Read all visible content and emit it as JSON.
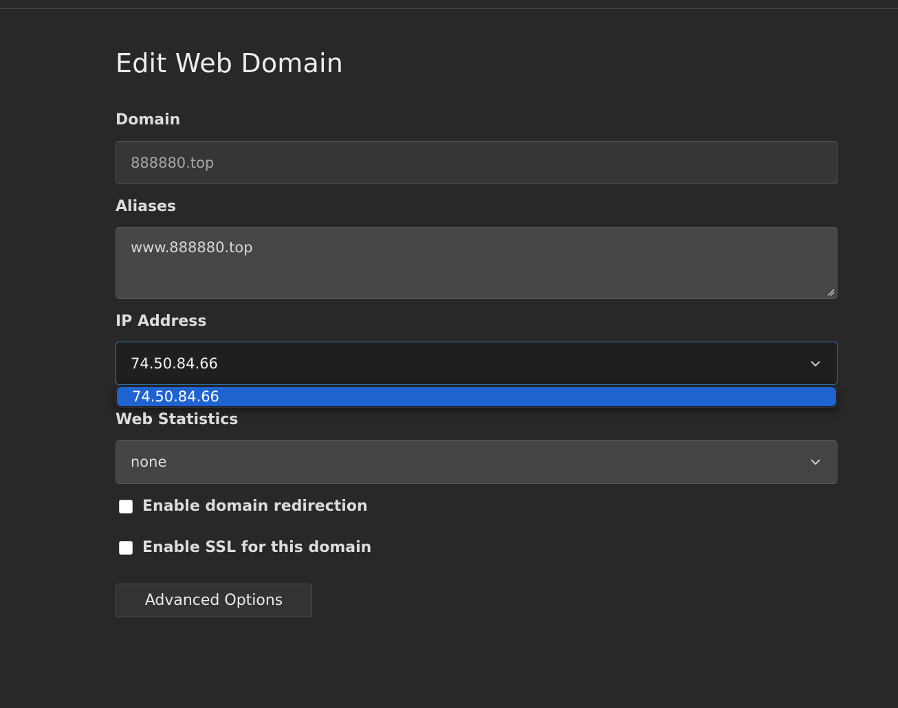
{
  "page": {
    "title": "Edit Web Domain"
  },
  "domain": {
    "label": "Domain",
    "value": "888880.top"
  },
  "aliases": {
    "label": "Aliases",
    "value": "www.888880.top"
  },
  "ip_address": {
    "label": "IP Address",
    "selected": "74.50.84.66",
    "options": [
      "74.50.84.66"
    ]
  },
  "web_statistics": {
    "label": "Web Statistics",
    "selected": "none"
  },
  "checkboxes": {
    "redirection_label": "Enable domain redirection",
    "ssl_label": "Enable SSL for this domain"
  },
  "buttons": {
    "advanced_label": "Advanced Options"
  },
  "colors": {
    "background": "#282828",
    "focus_border": "#2f79c4",
    "option_highlight": "#1f63d1"
  },
  "icons": {
    "select_arrow": "chevron-down-icon",
    "textarea_resize": "resize-handle-icon"
  }
}
